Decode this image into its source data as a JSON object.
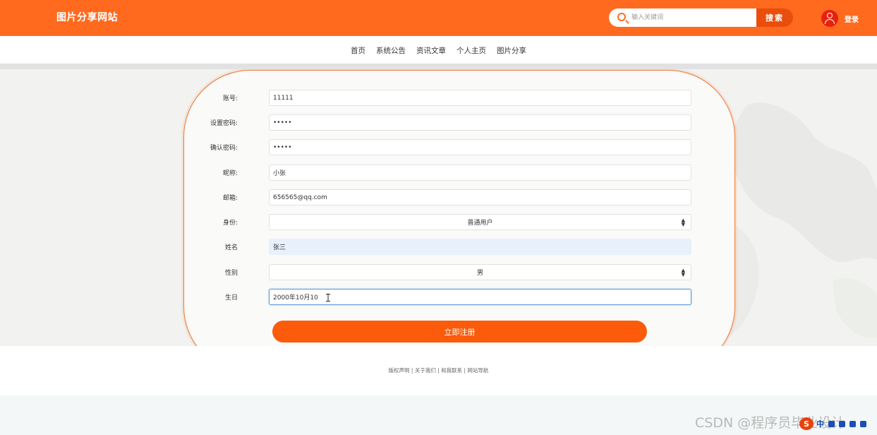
{
  "header": {
    "title": "图片分享网站",
    "search_placeholder": "输入关键词",
    "search_button": "搜索",
    "login_label": "登录"
  },
  "nav": {
    "items": [
      {
        "label": "首页"
      },
      {
        "label": "系统公告"
      },
      {
        "label": "资讯文章"
      },
      {
        "label": "个人主页"
      },
      {
        "label": "图片分享"
      }
    ]
  },
  "form": {
    "fields": [
      {
        "label": "账号:",
        "value": "11111"
      },
      {
        "label": "设置密码:",
        "value": "•••••"
      },
      {
        "label": "确认密码:",
        "value": "•••••"
      },
      {
        "label": "昵称:",
        "value": "小张"
      },
      {
        "label": "邮箱:",
        "value": "656565@qq.com"
      },
      {
        "label": "身份:",
        "value": "普通用户"
      },
      {
        "label": "姓名",
        "value": "张三"
      },
      {
        "label": "性别",
        "value": "男"
      },
      {
        "label": "生日",
        "value": "2000年10月10"
      }
    ],
    "submit_label": "立即注册"
  },
  "footer": {
    "links": "版权声明 | 关于我们 | 和我联系 | 网站导航"
  },
  "watermark": {
    "text": "CSDN @程序员毕业设计"
  },
  "ime": {
    "logo": "S",
    "lang": "中"
  },
  "colors": {
    "primary": "#ff6a1f",
    "button": "#fb5b0a",
    "search_button": "#e94e0c"
  }
}
